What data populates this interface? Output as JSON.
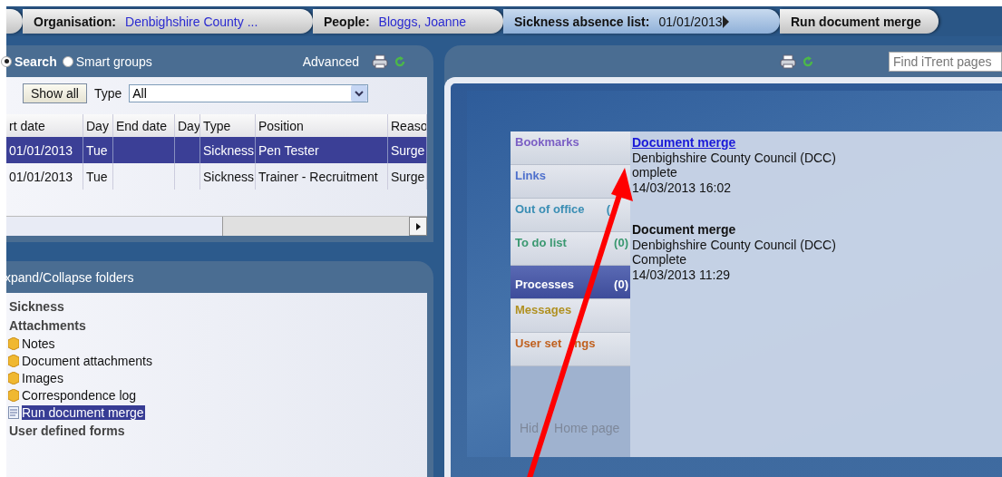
{
  "breadcrumbs": [
    {
      "kind": "stub",
      "selected": false
    },
    {
      "label": "Organisation:",
      "value": "Denbighshire County ...",
      "kind": "link",
      "selected": false
    },
    {
      "label": "People:",
      "value": "Bloggs, Joanne",
      "kind": "link",
      "selected": false
    },
    {
      "label": "Sickness absence list:",
      "value": "01/01/2013",
      "kind": "menu",
      "selected": true
    },
    {
      "label": "Run document merge",
      "kind": "current",
      "selected": false
    }
  ],
  "search_panel": {
    "modes": [
      {
        "label": "Search",
        "selected": true
      },
      {
        "label": "Smart groups",
        "selected": false
      }
    ],
    "advanced": "Advanced"
  },
  "filter": {
    "button": "Show all",
    "type_label": "Type",
    "type_value": "All"
  },
  "table": {
    "columns": [
      "rt date",
      "Day",
      "End date",
      "Day",
      "Type",
      "Position",
      "Reaso"
    ],
    "rows": [
      {
        "cells": [
          "01/01/2013",
          "Tue",
          "",
          "",
          "Sickness",
          "Pen Tester",
          "Surge"
        ],
        "selected": true
      },
      {
        "cells": [
          "01/01/2013",
          "Tue",
          "",
          "",
          "Sickness",
          "Trainer - Recruitment",
          "Surge"
        ],
        "selected": false
      }
    ]
  },
  "folders": {
    "title": "xpand/Collapse folders",
    "items": [
      {
        "label": "Sickness",
        "kind": "heading"
      },
      {
        "label": "Attachments",
        "kind": "heading",
        "children": [
          {
            "label": "Notes",
            "kind": "folder",
            "selected": false
          },
          {
            "label": "Document attachments",
            "kind": "folder",
            "selected": false
          },
          {
            "label": "Images",
            "kind": "folder",
            "selected": false
          },
          {
            "label": "Correspondence log",
            "kind": "folder",
            "selected": false
          },
          {
            "label": "Run document merge",
            "kind": "document",
            "selected": true
          }
        ]
      },
      {
        "label": "User defined forms",
        "kind": "heading"
      }
    ]
  },
  "find_field": {
    "placeholder": "Find iTrent pages"
  },
  "home_tabs": [
    {
      "label": "Bookmarks",
      "color": "#7a5ec4",
      "selected": false
    },
    {
      "label": "Links",
      "color": "#4d6fcc",
      "selected": false
    },
    {
      "label": "Out of office",
      "count": "(",
      "color": "#3a8eb4",
      "selected": false
    },
    {
      "label": "To do list",
      "count": "(0)",
      "color": "#3a9870",
      "selected": false
    },
    {
      "label": "Processes",
      "count": "(0)",
      "color": "#ffffff",
      "selected": true
    },
    {
      "label": "Messages",
      "color": "#b09020",
      "selected": false
    },
    {
      "label": "User set",
      "label_after": "ngs",
      "color": "#c0601e",
      "selected": false
    }
  ],
  "hide_home": {
    "before": "Hid",
    "after": "Home page"
  },
  "processes": [
    {
      "title": "Document merge",
      "kind": "link",
      "org": "Denbighshire County Council (DCC)",
      "status": "omplete",
      "time": "14/03/2013 16:02"
    },
    {
      "title": "Document merge",
      "kind": "text",
      "org": "Denbighshire County Council (DCC)",
      "status": "Complete",
      "time": "14/03/2013 11:29"
    }
  ]
}
